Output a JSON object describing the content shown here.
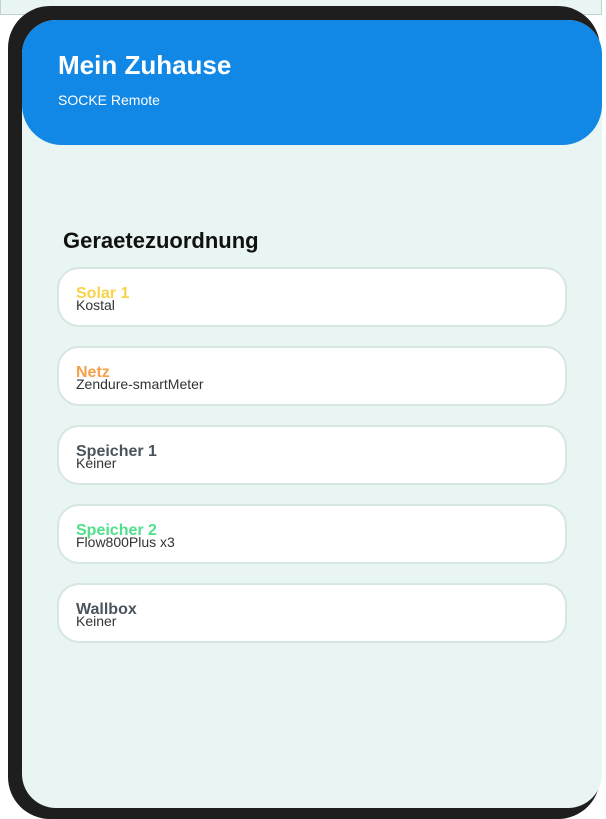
{
  "header": {
    "title": "Mein Zuhause",
    "subtitle": "SOCKE Remote",
    "color": "#1288e6"
  },
  "section": {
    "title": "Geraetezuordnung"
  },
  "devices": [
    {
      "name": "Solar 1",
      "value": "Kostal",
      "color": "#f7d34a"
    },
    {
      "name": "Netz",
      "value": "Zendure-smartMeter",
      "color": "#f5a04a"
    },
    {
      "name": "Speicher 1",
      "value": "Keiner",
      "color": "#4a545c"
    },
    {
      "name": "Speicher 2",
      "value": "Flow800Plus x3",
      "color": "#4fe08a"
    },
    {
      "name": "Wallbox",
      "value": "Keiner",
      "color": "#4a545c"
    }
  ]
}
